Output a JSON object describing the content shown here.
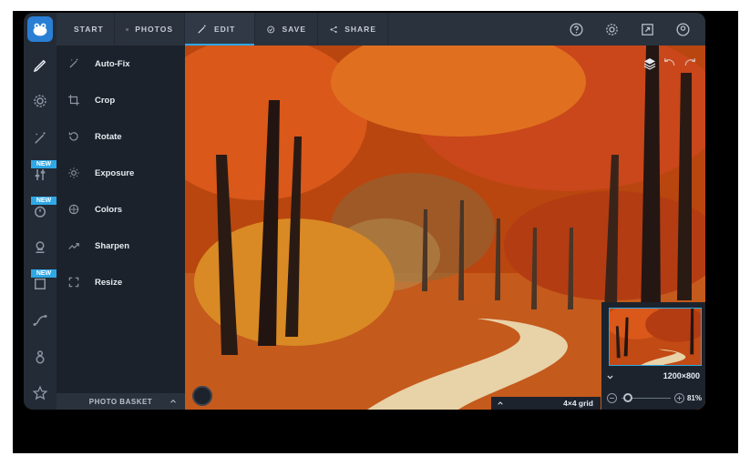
{
  "app": {
    "accent": "#2fa8e6",
    "logo_icon": "frog-logo-icon"
  },
  "rail": {
    "items": [
      {
        "icon": "pencil-icon",
        "active": true
      },
      {
        "icon": "gear-icon"
      },
      {
        "icon": "magic-wand-icon"
      },
      {
        "icon": "sliders-icon",
        "badge": "NEW"
      },
      {
        "icon": "timer-icon",
        "badge": "NEW"
      },
      {
        "icon": "stamp-icon"
      },
      {
        "icon": "frame-icon",
        "badge": "NEW"
      },
      {
        "icon": "curve-icon"
      },
      {
        "icon": "snowman-icon"
      },
      {
        "icon": "star-icon"
      }
    ]
  },
  "topbar": {
    "tabs": [
      {
        "label": "START",
        "icon": "home-icon"
      },
      {
        "label": "PHOTOS",
        "icon": "image-icon"
      },
      {
        "label": "EDIT",
        "icon": "magic-wand-icon",
        "active": true
      },
      {
        "label": "SAVE",
        "icon": "check-circle-icon"
      },
      {
        "label": "SHARE",
        "icon": "share-icon"
      }
    ],
    "right_icons": [
      "help-icon",
      "settings-icon",
      "fullscreen-icon",
      "account-icon"
    ]
  },
  "panel": {
    "tools": [
      {
        "label": "Auto-Fix",
        "icon": "magic-wand-icon"
      },
      {
        "label": "Crop",
        "icon": "crop-icon"
      },
      {
        "label": "Rotate",
        "icon": "rotate-icon"
      },
      {
        "label": "Exposure",
        "icon": "sun-icon"
      },
      {
        "label": "Colors",
        "icon": "color-wheel-icon"
      },
      {
        "label": "Sharpen",
        "icon": "sharpen-icon"
      },
      {
        "label": "Resize",
        "icon": "resize-icon"
      }
    ],
    "basket_label": "PHOTO BASKET"
  },
  "canvas": {
    "grid_label": "4×4 grid"
  },
  "navigator": {
    "resolution": "1200×800",
    "zoom_label": "81%",
    "zoom_level": 0.81
  }
}
